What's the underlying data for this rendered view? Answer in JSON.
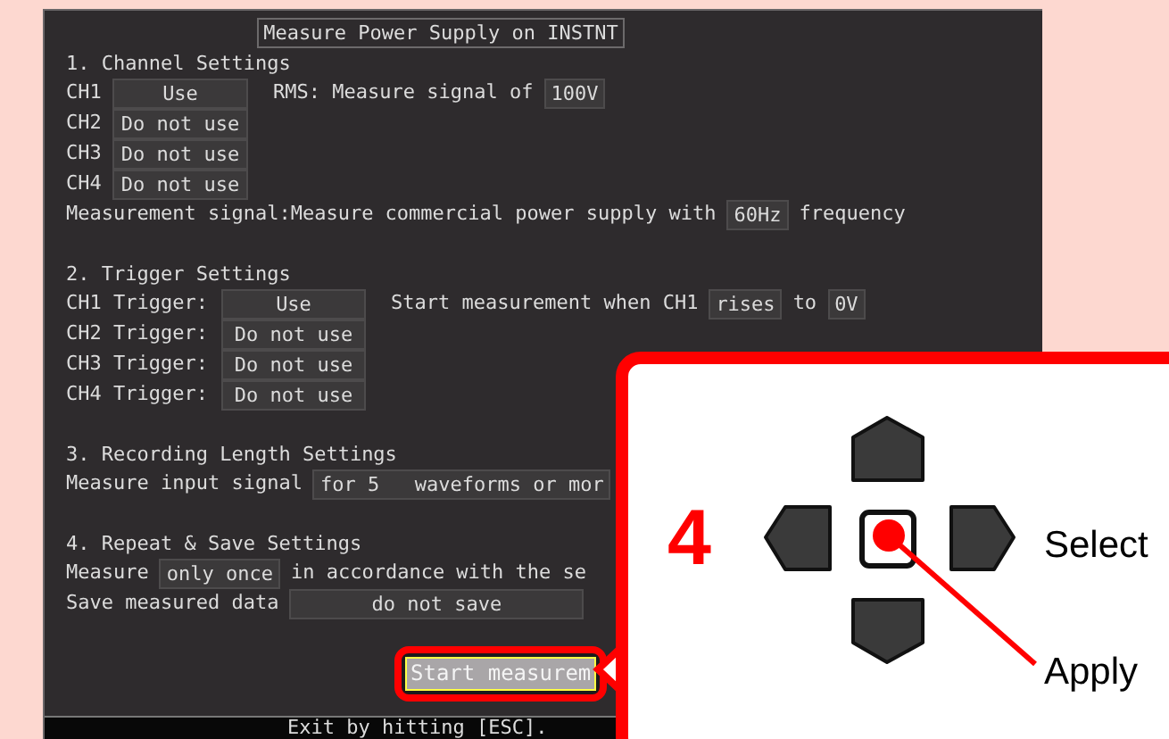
{
  "dialog_title": "Measure Power Supply on INSTNT",
  "sections": [
    {
      "kind": "channels",
      "heading": "1. Channel Settings",
      "rows": [
        {
          "label": "CH1",
          "value": "Use",
          "extra": [
            {
              "kind": "text",
              "text": "RMS: Measure signal of"
            },
            {
              "kind": "field",
              "text": "100V"
            }
          ]
        },
        {
          "label": "CH2",
          "value": "Do not use",
          "extra": []
        },
        {
          "label": "CH3",
          "value": "Do not use",
          "extra": []
        },
        {
          "label": "CH4",
          "value": "Do not use",
          "extra": []
        }
      ],
      "lines": [
        [
          {
            "kind": "text",
            "text": "Measurement signal:Measure commercial power supply with"
          },
          {
            "kind": "field",
            "text": "60Hz"
          },
          {
            "kind": "text",
            "text": "frequency"
          }
        ]
      ]
    },
    {
      "kind": "channels",
      "heading": "2. Trigger Settings",
      "rows": [
        {
          "label": "CH1 Trigger:",
          "value": "Use",
          "extra": [
            {
              "kind": "text",
              "text": "Start measurement when CH1"
            },
            {
              "kind": "field",
              "text": "rises"
            },
            {
              "kind": "text",
              "text": "to"
            },
            {
              "kind": "field",
              "text": "0V"
            }
          ]
        },
        {
          "label": "CH2 Trigger:",
          "value": "Do not use",
          "extra": []
        },
        {
          "label": "CH3 Trigger:",
          "value": "Do not use",
          "extra": []
        },
        {
          "label": "CH4 Trigger:",
          "value": "Do not use",
          "extra": []
        }
      ]
    },
    {
      "kind": "lines",
      "heading": "3. Recording Length Settings",
      "lines": [
        [
          {
            "kind": "text",
            "text": "Measure input signal"
          },
          {
            "kind": "field",
            "text": "for 5   waveforms or mor"
          }
        ]
      ]
    },
    {
      "kind": "lines",
      "heading": "4. Repeat & Save Settings",
      "lines": [
        [
          {
            "kind": "text",
            "text": "Measure"
          },
          {
            "kind": "field",
            "text": "only once"
          },
          {
            "kind": "text",
            "text": "in accordance with the se"
          }
        ],
        [
          {
            "kind": "text",
            "text": "Save measured data"
          },
          {
            "kind": "wide_field",
            "text": "do not save"
          }
        ]
      ]
    }
  ],
  "start_button": {
    "label": "Start measurem",
    "selected": true
  },
  "status_bar": "Exit by hitting [ESC].",
  "callout": {
    "step": "4",
    "labels": [
      "Select",
      "Apply"
    ]
  }
}
